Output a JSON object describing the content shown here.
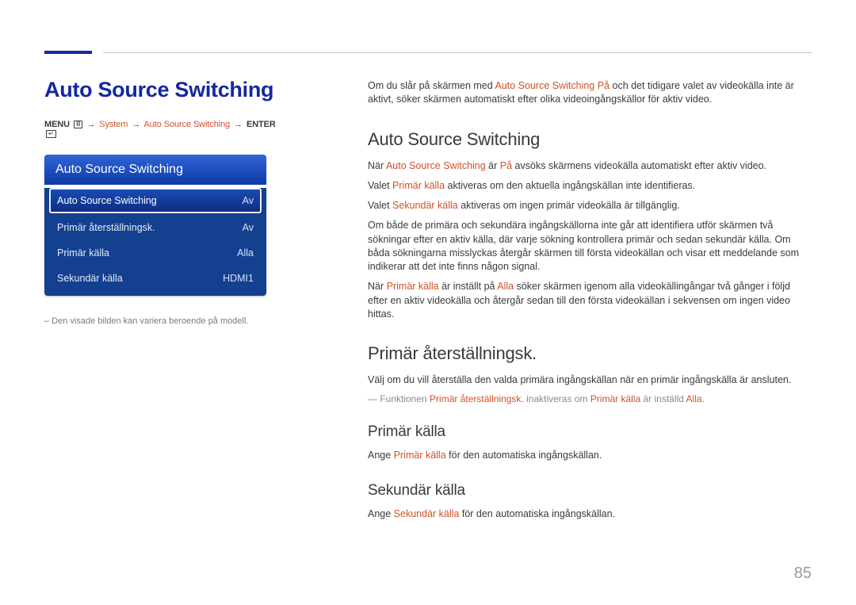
{
  "page_number": "85",
  "colors": {
    "brand": "#1428a0",
    "accent": "#d05028"
  },
  "left": {
    "title": "Auto Source Switching",
    "breadcrumb": {
      "menu_label": "MENU",
      "items": [
        "System",
        "Auto Source Switching"
      ],
      "enter_label": "ENTER"
    },
    "menu": {
      "header": "Auto Source Switching",
      "rows": [
        {
          "label": "Auto Source Switching",
          "value": "Av",
          "selected": true
        },
        {
          "label": "Primär återställningsk.",
          "value": "Av",
          "selected": false
        },
        {
          "label": "Primär källa",
          "value": "Alla",
          "selected": false
        },
        {
          "label": "Sekundär källa",
          "value": "HDMI1",
          "selected": false
        }
      ]
    },
    "note": "– Den visade bilden kan variera beroende på modell."
  },
  "right": {
    "intro": {
      "p1a": "Om du slår på skärmen med ",
      "p1b": "Auto Source Switching På",
      "p1c": " och det tidigare valet av videokälla inte är aktivt, söker skärmen automatiskt efter olika videoingångskällor för aktiv video."
    },
    "s1": {
      "heading": "Auto Source Switching",
      "p1a": "När ",
      "p1b": "Auto Source Switching",
      "p1c": " är ",
      "p1d": "På",
      "p1e": " avsöks skärmens videokälla automatiskt efter aktiv video.",
      "p2a": "Valet ",
      "p2b": "Primär källa",
      "p2c": " aktiveras om den aktuella ingångskällan inte identifieras.",
      "p3a": "Valet ",
      "p3b": "Sekundär källa",
      "p3c": " aktiveras om ingen primär videokälla är tillgänglig.",
      "p4": "Om både de primära och sekundära ingångskällorna inte går att identifiera utför skärmen två sökningar efter en aktiv källa, där varje sökning kontrollera primär och sedan sekundär källa. Om båda sökningarna misslyckas återgår skärmen till första videokällan och visar ett meddelande som indikerar att det inte finns någon signal.",
      "p5a": "När ",
      "p5b": "Primär källa",
      "p5c": " är inställt på ",
      "p5d": "Alla",
      "p5e": " söker skärmen igenom alla videokällingångar två gånger i följd efter en aktiv videokälla och återgår sedan till den första videokällan i sekvensen om ingen video hittas."
    },
    "s2": {
      "heading": "Primär återställningsk.",
      "p1": "Välj om du vill återställa den valda primära ingångskällan när en primär ingångskälla är ansluten.",
      "note_a": "― Funktionen ",
      "note_b": "Primär återställningsk.",
      "note_c": " inaktiveras om ",
      "note_d": "Primär källa",
      "note_e": " är inställd ",
      "note_f": "Alla",
      "note_g": "."
    },
    "s3": {
      "heading": "Primär källa",
      "p1a": "Ange ",
      "p1b": "Primär källa",
      "p1c": " för den automatiska ingångskällan."
    },
    "s4": {
      "heading": "Sekundär källa",
      "p1a": "Ange ",
      "p1b": "Sekundär källa",
      "p1c": " för den automatiska ingångskällan."
    }
  }
}
